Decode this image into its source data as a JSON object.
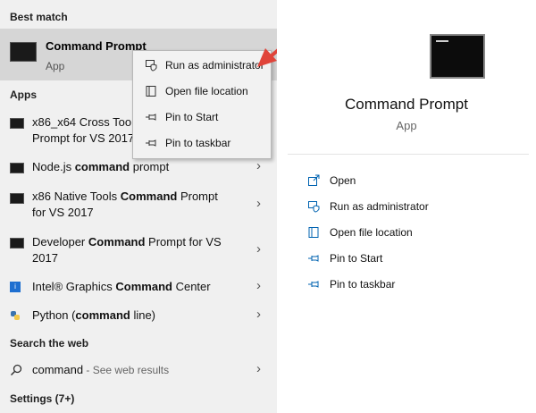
{
  "left": {
    "best_match_header": "Best match",
    "best_match": {
      "title": "Command Prompt",
      "subtitle": "App"
    },
    "apps_header": "Apps",
    "apps": [
      {
        "pre": "x86_x64 Cross Too",
        "bold": "",
        "post": "",
        "line2": "Prompt for VS 2017"
      },
      {
        "pre": "Node.js ",
        "bold": "command",
        "post": " prompt",
        "line2": ""
      },
      {
        "pre": "x86 Native Tools ",
        "bold": "Command",
        "post": " Prompt",
        "line2": "for VS 2017"
      },
      {
        "pre": "Developer ",
        "bold": "Command",
        "post": " Prompt for VS",
        "line2": "2017"
      },
      {
        "pre": "Intel® Graphics ",
        "bold": "Command",
        "post": " Center",
        "line2": ""
      },
      {
        "pre": "Python (",
        "bold": "command",
        "post": " line)",
        "line2": ""
      }
    ],
    "search_web_header": "Search the web",
    "web_query": "command",
    "web_suffix": " - See web results",
    "settings_header": "Settings (7+)"
  },
  "context_menu": {
    "items": [
      "Run as administrator",
      "Open file location",
      "Pin to Start",
      "Pin to taskbar"
    ]
  },
  "preview": {
    "title": "Command Prompt",
    "subtitle": "App",
    "actions": [
      "Open",
      "Run as administrator",
      "Open file location",
      "Pin to Start",
      "Pin to taskbar"
    ]
  },
  "colors": {
    "accent": "#0063b1",
    "arrow": "#e0443a",
    "highlight": "#d6d6d6"
  },
  "icons": [
    "terminal-icon",
    "shield-icon",
    "folder-icon",
    "pin-icon",
    "search-icon",
    "chevron-right-icon"
  ]
}
